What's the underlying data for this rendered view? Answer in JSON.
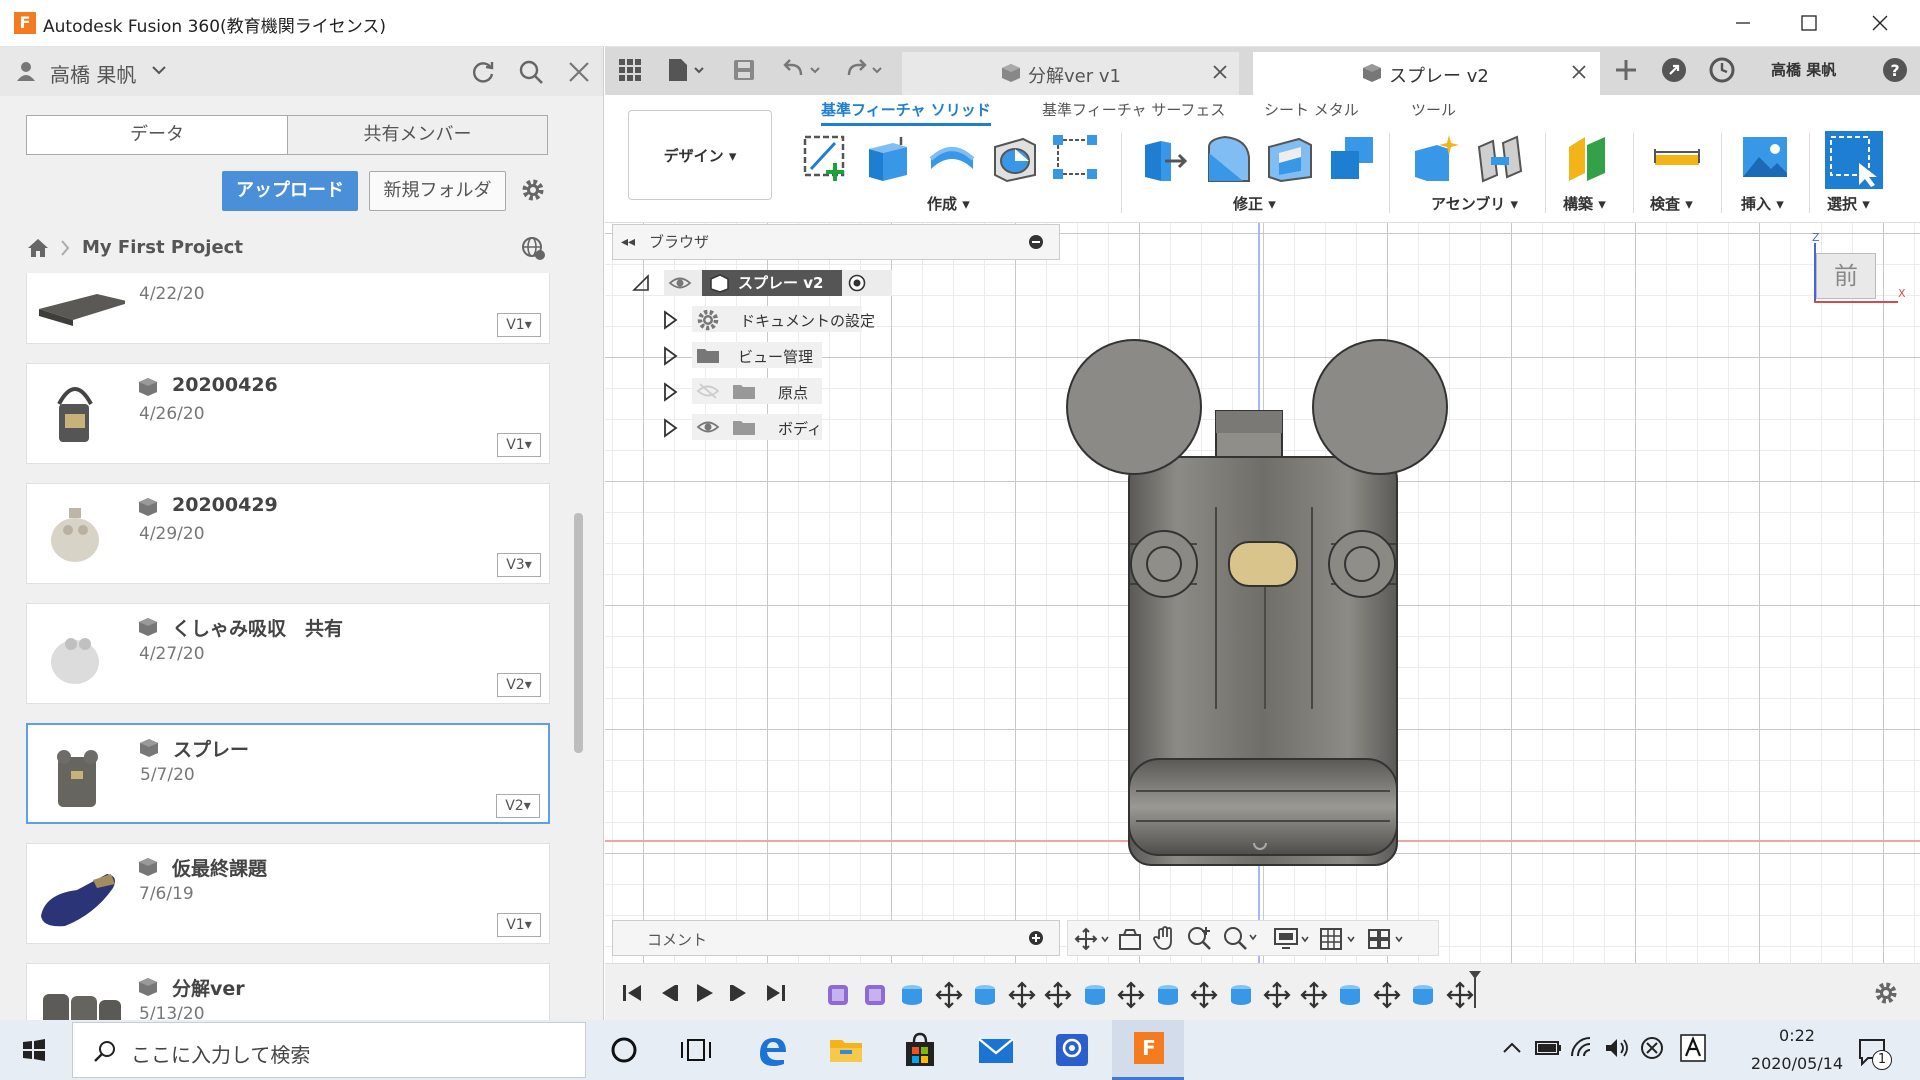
{
  "window": {
    "title": "Autodesk Fusion 360(教育機関ライセンス)",
    "logo_letter": "F"
  },
  "data_panel": {
    "user_name": "高橋 果帆",
    "tabs": [
      "データ",
      "共有メンバー"
    ],
    "upload_label": "アップロード",
    "new_folder_label": "新規フォルダ",
    "project_name": "My First Project",
    "files": [
      {
        "name": "",
        "date": "4/22/20",
        "version": "V1"
      },
      {
        "name": "20200426",
        "date": "4/26/20",
        "version": "V1"
      },
      {
        "name": "20200429",
        "date": "4/29/20",
        "version": "V3"
      },
      {
        "name": "くしゃみ吸収　共有",
        "date": "4/27/20",
        "version": "V2"
      },
      {
        "name": "スプレー",
        "date": "5/7/20",
        "version": "V2",
        "selected": true
      },
      {
        "name": "仮最終課題",
        "date": "7/6/19",
        "version": "V1"
      },
      {
        "name": "分解ver",
        "date": "5/13/20",
        "version": ""
      }
    ]
  },
  "doc_tabs": [
    {
      "label": "分解ver v1",
      "active": false
    },
    {
      "label": "スプレー v2",
      "active": true
    }
  ],
  "header_user": "高橋 果帆",
  "ribbon": {
    "workspace": "デザイン",
    "tabs": [
      "基準フィーチャ ソリッド",
      "基準フィーチャ サーフェス",
      "シート メタル",
      "ツール"
    ],
    "groups": [
      "作成",
      "修正",
      "アセンブリ",
      "構築",
      "検査",
      "挿入",
      "選択"
    ]
  },
  "browser": {
    "title": "ブラウザ",
    "root": "スプレー v2",
    "items": [
      "ドキュメントの設定",
      "ビュー管理",
      "原点",
      "ボディ"
    ]
  },
  "comment_label": "コメント",
  "viewcube_label": "前",
  "viewcube_axes": {
    "z": "Z",
    "x": "X"
  },
  "taskbar": {
    "search_placeholder": "ここに入力して検索",
    "time": "0:22",
    "date": "2020/05/14",
    "notification_count": "1"
  },
  "colors": {
    "accent": "#1e7fd2",
    "upload": "#4a8fd8",
    "model_body": "#7b7a75",
    "model_button": "#d9c58c"
  }
}
